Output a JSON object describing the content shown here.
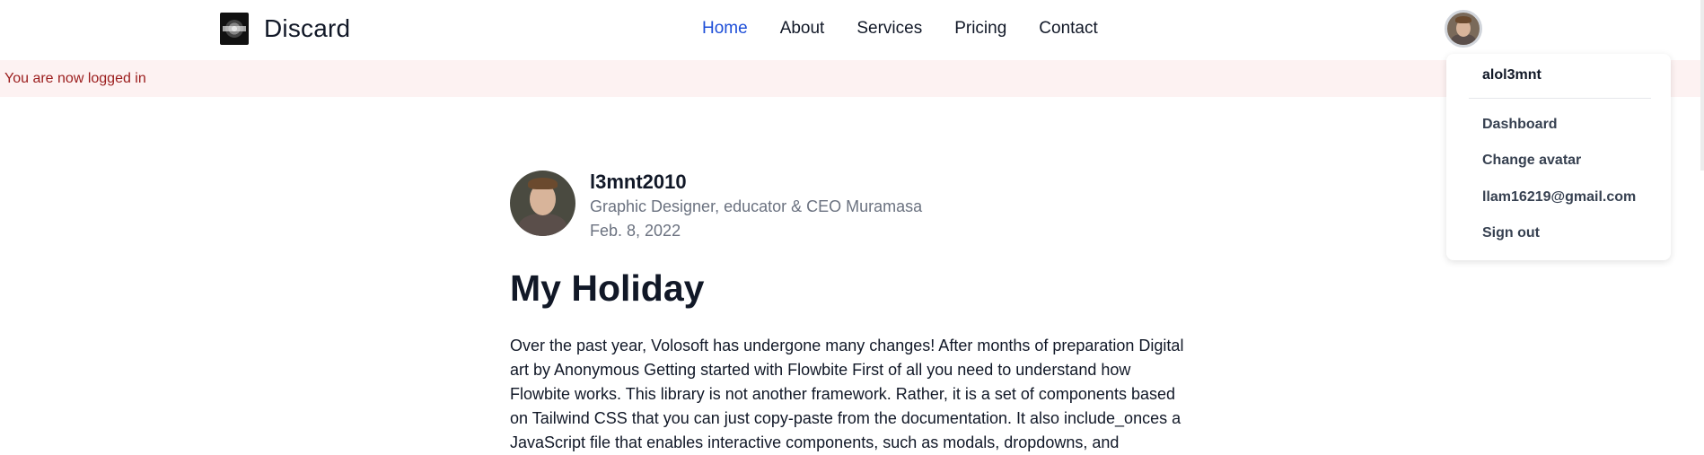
{
  "nav": {
    "brand": "Discard",
    "logo_icon": "discard-logo-icon",
    "links": [
      {
        "label": "Home",
        "active": true
      },
      {
        "label": "About",
        "active": false
      },
      {
        "label": "Services",
        "active": false
      },
      {
        "label": "Pricing",
        "active": false
      },
      {
        "label": "Contact",
        "active": false
      }
    ],
    "active_color": "#1d4ed8"
  },
  "alert": {
    "text": "You are now logged in",
    "background": "#fdf2f2",
    "color": "#9b1c1c"
  },
  "user_menu": {
    "username": "alol3mnt",
    "items": [
      {
        "label": "Dashboard"
      },
      {
        "label": "Change avatar"
      },
      {
        "label": "llam16219@gmail.com"
      },
      {
        "label": "Sign out"
      }
    ]
  },
  "article": {
    "author": {
      "name": "l3mnt2010",
      "role": "Graphic Designer, educator & CEO Muramasa",
      "date": "Feb. 8, 2022"
    },
    "title": "My Holiday",
    "body": "Over the past year, Volosoft has undergone many changes! After months of preparation Digital art by Anonymous Getting started with Flowbite First of all you need to understand how Flowbite works. This library is not another framework. Rather, it is a set of components based on Tailwind CSS that you can just copy-paste from the documentation. It also include_onces a JavaScript file that enables interactive components, such as modals, dropdowns, and"
  }
}
